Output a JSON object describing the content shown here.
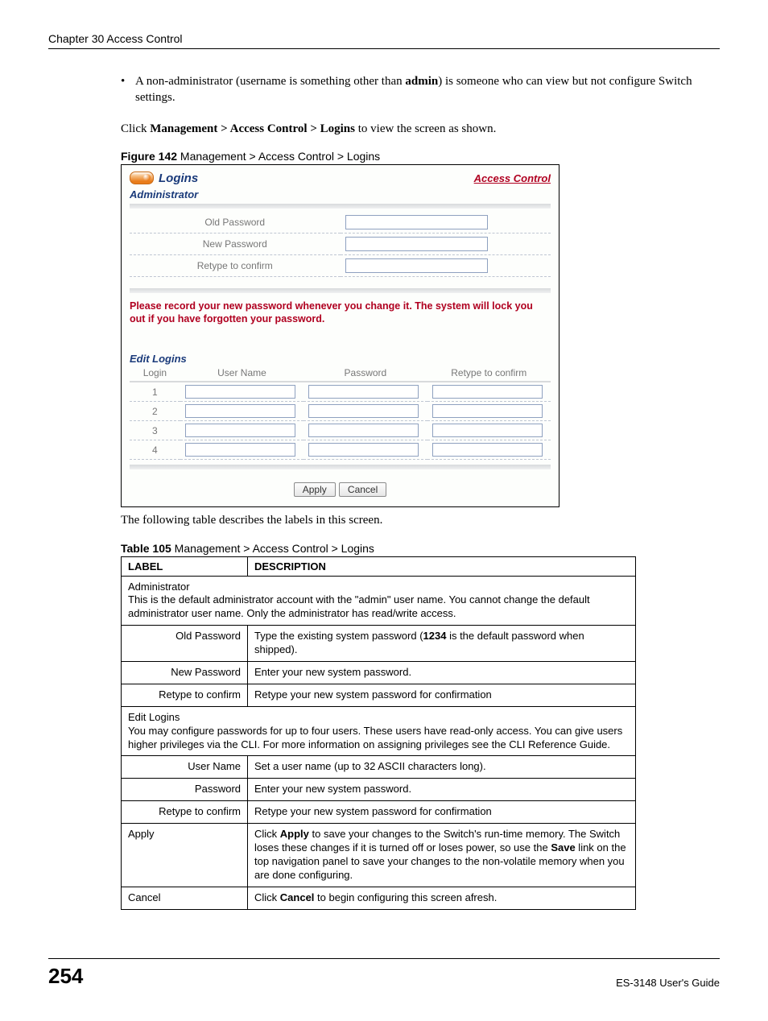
{
  "header": {
    "chapter": "Chapter 30 Access Control"
  },
  "intro": {
    "bullet_pre": "A non-administrator (username is something other than ",
    "bullet_bold": "admin",
    "bullet_post": ") is someone who can view but not configure Switch settings.",
    "click_pre": "Click ",
    "click_path": "Management > Access Control > Logins",
    "click_post": " to view the screen as shown."
  },
  "figure": {
    "label_bold": "Figure 142",
    "label_rest": "   Management > Access Control > Logins"
  },
  "screenshot": {
    "logins_title": "Logins",
    "access_control_link": "Access Control",
    "administrator": "Administrator",
    "old_password": "Old Password",
    "new_password": "New Password",
    "retype": "Retype to confirm",
    "warning": "Please record your new password whenever you change it. The system will lock you out if you have forgotten your password.",
    "edit_logins": "Edit Logins",
    "cols": {
      "login": "Login",
      "username": "User Name",
      "password": "Password",
      "retype": "Retype to confirm"
    },
    "rows": [
      "1",
      "2",
      "3",
      "4"
    ],
    "apply": "Apply",
    "cancel": "Cancel"
  },
  "after_figure": "The following table describes the labels in this screen.",
  "table_caption": {
    "bold": "Table 105",
    "rest": "   Management > Access Control > Logins"
  },
  "table": {
    "h1": "LABEL",
    "h2": "DESCRIPTION",
    "admin_section": "Administrator",
    "admin_desc": "This is the default administrator account with the \"admin\" user name. You cannot change the default administrator user name. Only the administrator has read/write access.",
    "oldpw_l": "Old Password",
    "oldpw_d_pre": "Type the existing system password (",
    "oldpw_d_bold": "1234",
    "oldpw_d_post": " is the default password when shipped).",
    "newpw_l": "New Password",
    "newpw_d": "Enter your new system password.",
    "retype_l": "Retype to confirm",
    "retype_d": "Retype your new system password for confirmation",
    "edit_section": "Edit Logins",
    "edit_desc": "You may configure passwords for up to four users. These users have read-only access. You can give users higher privileges via the CLI. For more information on assigning privileges see the CLI Reference Guide.",
    "uname_l": "User Name",
    "uname_d": "Set a user name (up to 32 ASCII characters long).",
    "pw_l": "Password",
    "pw_d": "Enter your new system password.",
    "retype2_l": "Retype to confirm",
    "retype2_d": "Retype your new system password for confirmation",
    "apply_l": "Apply",
    "apply_d_pre": "Click ",
    "apply_d_b1": "Apply",
    "apply_d_mid": " to save your changes to the Switch's run-time memory. The Switch loses these changes if it is turned off or loses power, so use the ",
    "apply_d_b2": "Save",
    "apply_d_post": " link on the top navigation panel to save your changes to the non-volatile memory when you are done configuring.",
    "cancel_l": "Cancel",
    "cancel_d_pre": "Click ",
    "cancel_d_b": "Cancel",
    "cancel_d_post": " to begin configuring this screen afresh."
  },
  "footer": {
    "page": "254",
    "guide": "ES-3148 User's Guide"
  }
}
